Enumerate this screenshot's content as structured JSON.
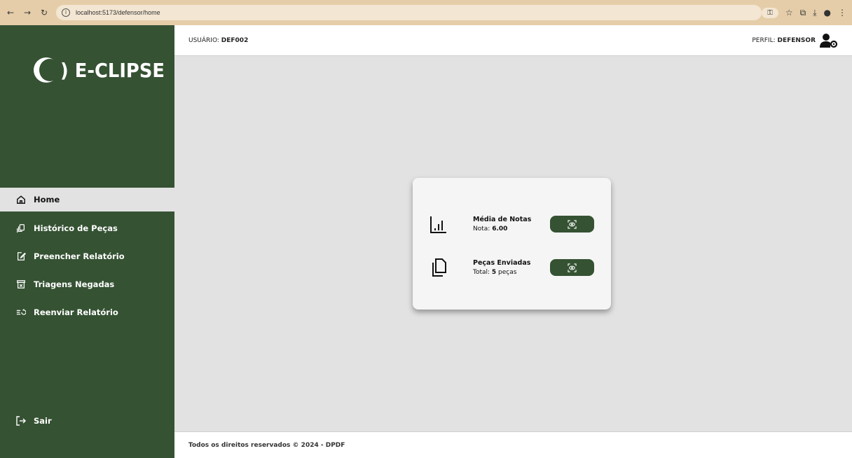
{
  "browser": {
    "url": "localhost:5173/defensor/home"
  },
  "brand": {
    "name": ") E-CLIPSE",
    "primary_color": "#355233"
  },
  "sidebar": {
    "items": [
      {
        "label": "Home",
        "icon": "home-icon",
        "active": true
      },
      {
        "label": "Histórico de Peças",
        "icon": "history-pieces-icon"
      },
      {
        "label": "Preencher Relatório",
        "icon": "edit-report-icon"
      },
      {
        "label": "Triagens Negadas",
        "icon": "denied-box-icon"
      },
      {
        "label": "Reenviar Relatório",
        "icon": "resend-icon"
      }
    ],
    "logout": "Sair"
  },
  "header": {
    "user_label": "USUÁRIO: ",
    "user_value": "DEF002",
    "profile_label": "PERFIL: ",
    "profile_value": "DEFENSOR"
  },
  "stats": {
    "average": {
      "title": "Média de Notas",
      "prefix": "Nota: ",
      "value": "6.00",
      "icon": "bar-chart-icon"
    },
    "pieces": {
      "title": "Peças Enviadas",
      "prefix": "Total: ",
      "value": "5",
      "suffix": " peças",
      "icon": "documents-icon"
    }
  },
  "footer": {
    "text": "Todos os direitos reservados © 2024 - DPDF"
  }
}
